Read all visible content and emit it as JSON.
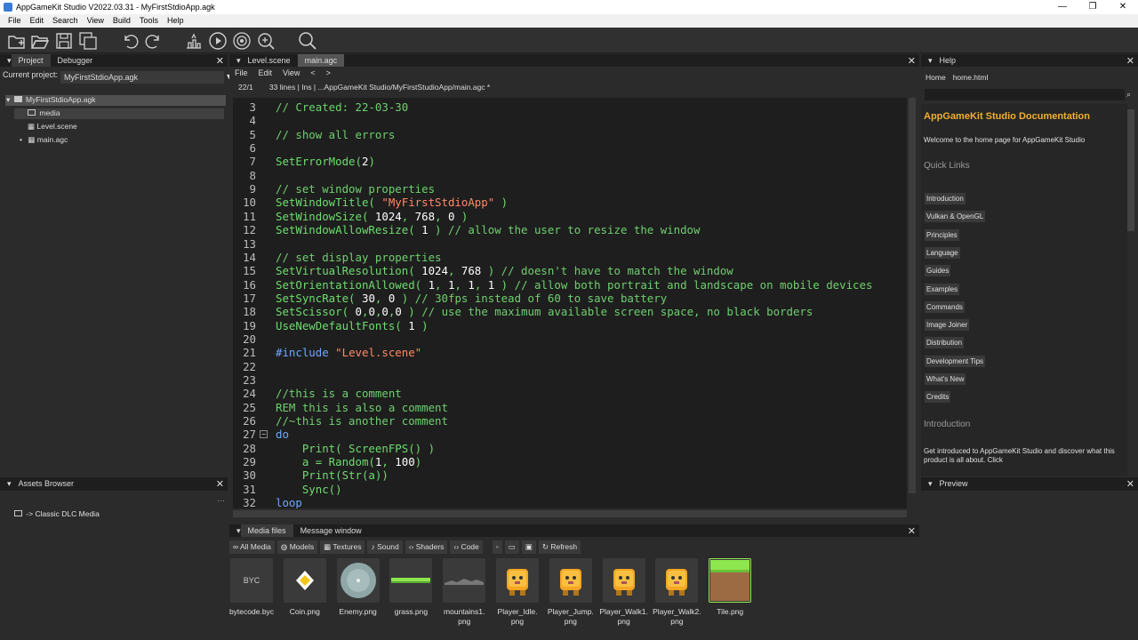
{
  "window": {
    "title": "AppGameKit Studio V2022.03.31 - MyFirstStdioApp.agk",
    "controls": [
      "—",
      "❐",
      "✕"
    ]
  },
  "menubar": {
    "items": [
      "File",
      "Edit",
      "Search",
      "View",
      "Build",
      "Tools",
      "Help"
    ]
  },
  "toolbar": {
    "icons": [
      "new-project-icon",
      "open-icon",
      "save-icon",
      "save-all-icon",
      "undo-icon",
      "redo-icon",
      "build-icon",
      "run-icon",
      "broadcast-icon",
      "debug-icon",
      "search-icon"
    ]
  },
  "left_panel": {
    "tabs": [
      "Project",
      "Debugger"
    ],
    "current_project_label": "Current project:",
    "current_project": "MyFirstStdioApp.agk",
    "tree": [
      {
        "label": "MyFirstStdioApp.agk",
        "icon": "folder-icon"
      },
      {
        "label": "media",
        "icon": "folder-icon"
      },
      {
        "label": "Level.scene",
        "icon": "grid-icon"
      },
      {
        "label": "main.agc",
        "icon": "grid-icon"
      }
    ]
  },
  "assets": {
    "title": "Assets Browser",
    "items": [
      "-> Classic DLC Media"
    ]
  },
  "editor": {
    "tabs": [
      "Level.scene",
      "main.agc"
    ],
    "menu": [
      "File",
      "Edit",
      "View",
      "<",
      ">"
    ],
    "status": {
      "pos": "22/1",
      "lines": "33 lines",
      "mode": "Ins",
      "path": "...AppGameKit Studio/MyFirstStudioApp/main.agc",
      "modified": "*"
    },
    "lines": [
      {
        "n": "3",
        "t": "// Created: 22-03-30"
      },
      {
        "n": "4",
        "t": ""
      },
      {
        "n": "5",
        "t": "// show all errors"
      },
      {
        "n": "6",
        "t": ""
      },
      {
        "n": "7",
        "t": "SetErrorMode(2)"
      },
      {
        "n": "8",
        "t": ""
      },
      {
        "n": "9",
        "t": "// set window properties"
      },
      {
        "n": "10",
        "t": "SetWindowTitle( \"MyFirstStdioApp\" )"
      },
      {
        "n": "11",
        "t": "SetWindowSize( 1024, 768, 0 )"
      },
      {
        "n": "12",
        "t": "SetWindowAllowResize( 1 ) // allow the user to resize the window"
      },
      {
        "n": "13",
        "t": ""
      },
      {
        "n": "14",
        "t": "// set display properties"
      },
      {
        "n": "15",
        "t": "SetVirtualResolution( 1024, 768 ) // doesn't have to match the window"
      },
      {
        "n": "16",
        "t": "SetOrientationAllowed( 1, 1, 1, 1 ) // allow both portrait and landscape on mobile devices"
      },
      {
        "n": "17",
        "t": "SetSyncRate( 30, 0 ) // 30fps instead of 60 to save battery"
      },
      {
        "n": "18",
        "t": "SetScissor( 0,0,0,0 ) // use the maximum available screen space, no black borders"
      },
      {
        "n": "19",
        "t": "UseNewDefaultFonts( 1 )"
      },
      {
        "n": "20",
        "t": ""
      },
      {
        "n": "21",
        "t": "#include \"Level.scene\""
      },
      {
        "n": "22",
        "t": ""
      },
      {
        "n": "23",
        "t": ""
      },
      {
        "n": "24",
        "t": "//this is a comment"
      },
      {
        "n": "25",
        "t": "REM this is also a comment"
      },
      {
        "n": "26",
        "t": "//~this is another comment"
      },
      {
        "n": "27",
        "t": "do"
      },
      {
        "n": "28",
        "t": "    Print( ScreenFPS() )"
      },
      {
        "n": "29",
        "t": "    a = Random(1, 100)"
      },
      {
        "n": "30",
        "t": "    Print(Str(a))"
      },
      {
        "n": "31",
        "t": "    Sync()"
      },
      {
        "n": "32",
        "t": "loop"
      }
    ]
  },
  "help": {
    "title": "Help",
    "nav": [
      "Home",
      "home.html"
    ],
    "doc_title": "AppGameKit Studio Documentation",
    "welcome": "Welcome to the home page for AppGameKit Studio",
    "quick_links_heading": "Quick Links",
    "links": [
      "Introduction",
      "Vulkan & OpenGL",
      "Principles",
      "Language",
      "Guides",
      "Examples",
      "Commands",
      "Image Joiner",
      "Distribution",
      "Development Tips",
      "What's New",
      "Credits"
    ],
    "intro_heading": "Introduction",
    "intro_text": "Get introduced to AppGameKit Studio and discover what this product is all about. Click"
  },
  "preview": {
    "title": "Preview"
  },
  "media_panel": {
    "tabs": [
      "Media files",
      "Message window"
    ],
    "filters": [
      "All Media",
      "Models",
      "Textures",
      "Sound",
      "Shaders",
      "Code"
    ],
    "refresh": "Refresh",
    "files": [
      {
        "name": "bytecode.byc",
        "thumb": "BYC"
      },
      {
        "name": "Coin.png"
      },
      {
        "name": "Enemy.png"
      },
      {
        "name": "grass.png"
      },
      {
        "name": "mountains1.\npng"
      },
      {
        "name": "Player_Idle.\npng"
      },
      {
        "name": "Player_Jump.\npng"
      },
      {
        "name": "Player_Walk1.\npng"
      },
      {
        "name": "Player_Walk2.\npng"
      },
      {
        "name": "Tile.png"
      }
    ]
  },
  "colors": {
    "accent": "#f0b030",
    "code_green": "#6fdc6f",
    "string": "#ff8a65",
    "keyword": "#6fa8ff"
  }
}
